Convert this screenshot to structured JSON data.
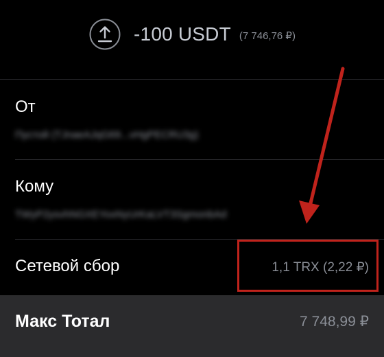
{
  "header": {
    "icon": "upload-arrow-icon",
    "amount": "-100 USDT",
    "fiat": "(7 746,76 ₽)"
  },
  "from": {
    "label": "От",
    "address": "Пустой (TJnaeAJqG69...vHgPECRU3g)"
  },
  "to": {
    "label": "Кому",
    "address": "TWyP2ysvhNGXEYoxNyUrKaLVT3SgmonbAd"
  },
  "fee": {
    "label": "Сетевой сбор",
    "value": "1,1 TRX (2,22 ₽)"
  },
  "total": {
    "label": "Макс Тотал",
    "value": "7 748,99 ₽"
  },
  "colors": {
    "background": "#000000",
    "total_row": "#2b2b2d",
    "annotation": "#c0231c",
    "muted_text": "#8a8e96"
  }
}
